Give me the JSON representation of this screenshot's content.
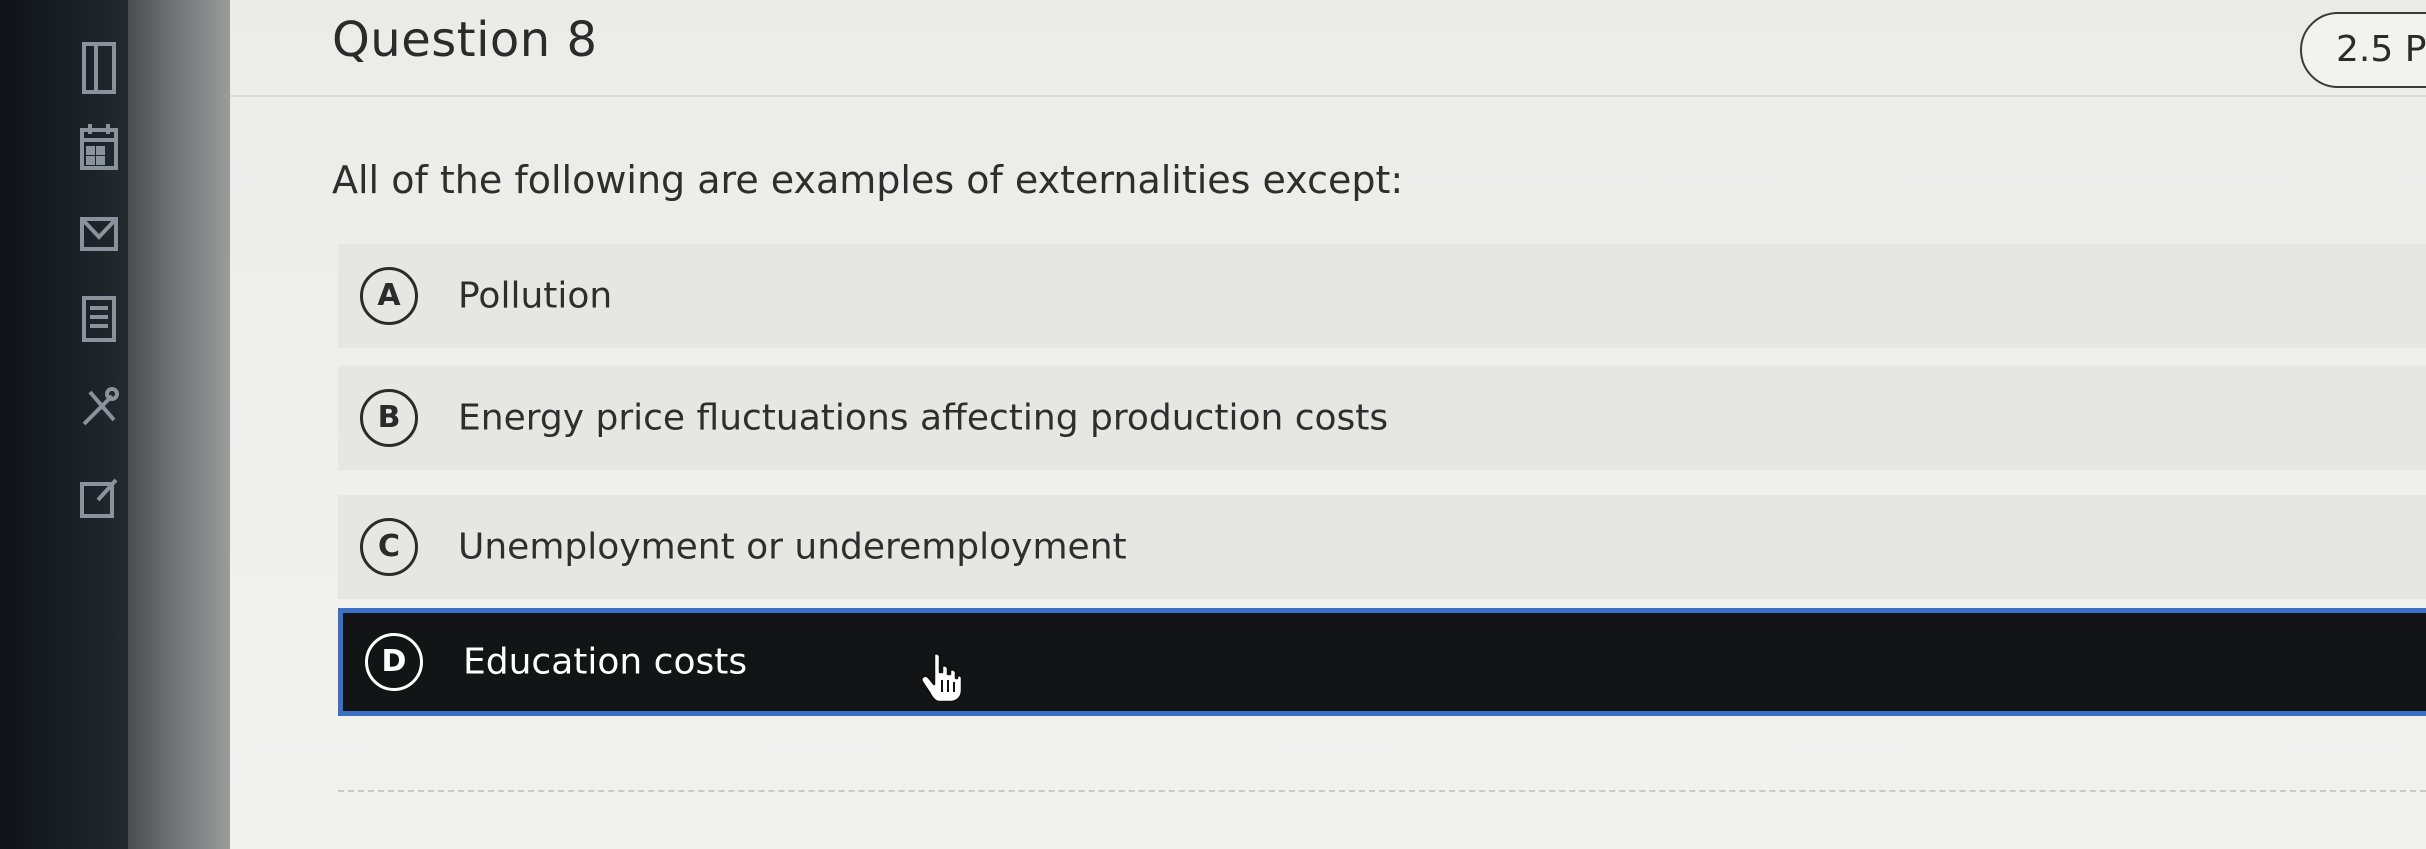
{
  "sidebar": {
    "icons": [
      {
        "name": "document-icon"
      },
      {
        "name": "calendar-icon"
      },
      {
        "name": "inbox-icon"
      },
      {
        "name": "list-icon"
      },
      {
        "name": "tools-icon"
      },
      {
        "name": "edit-icon"
      }
    ]
  },
  "question": {
    "title": "Question 8",
    "points": "2.5 P",
    "prompt": "All of the following are examples of externalities except:",
    "choices": [
      {
        "letter": "A",
        "text": "Pollution",
        "selected": false
      },
      {
        "letter": "B",
        "text": "Energy price fluctuations affecting production costs",
        "selected": false
      },
      {
        "letter": "C",
        "text": "Unemployment or underemployment",
        "selected": false
      },
      {
        "letter": "D",
        "text": "Education costs",
        "selected": true
      }
    ]
  },
  "colors": {
    "selected_background": "#121416",
    "selected_border": "#3b6fc4",
    "sidebar_background": "#1a2026"
  }
}
